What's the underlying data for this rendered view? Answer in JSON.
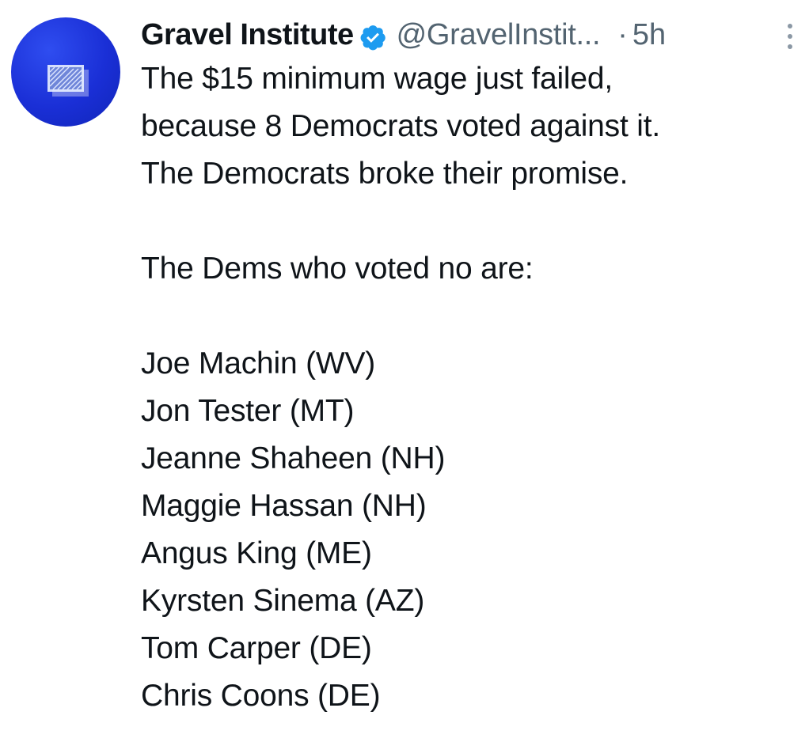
{
  "tweet": {
    "author": {
      "display_name": "Gravel Institute",
      "verified_icon": "verified-badge-icon",
      "handle": "@GravelInstit...",
      "avatar_icon": "gravel-institute-logo-icon"
    },
    "separator": "·",
    "time": "5h",
    "more_icon": "more-vertical-icon",
    "body": {
      "paragraph1": [
        "The $15 minimum wage just failed,",
        "because 8 Democrats voted against it.",
        "The Democrats broke their promise."
      ],
      "paragraph2": "The Dems who voted no are:",
      "names": [
        "Joe Machin (WV)",
        "Jon Tester (MT)",
        "Jeanne Shaheen (NH)",
        "Maggie Hassan (NH)",
        "Angus King (ME)",
        "Kyrsten Sinema (AZ)",
        "Tom Carper (DE)",
        "Chris Coons (DE)"
      ]
    }
  },
  "colors": {
    "text_primary": "#0f1419",
    "text_secondary": "#536471",
    "verified_blue": "#1d9bf0",
    "avatar_blue": "#1a2fd6"
  }
}
